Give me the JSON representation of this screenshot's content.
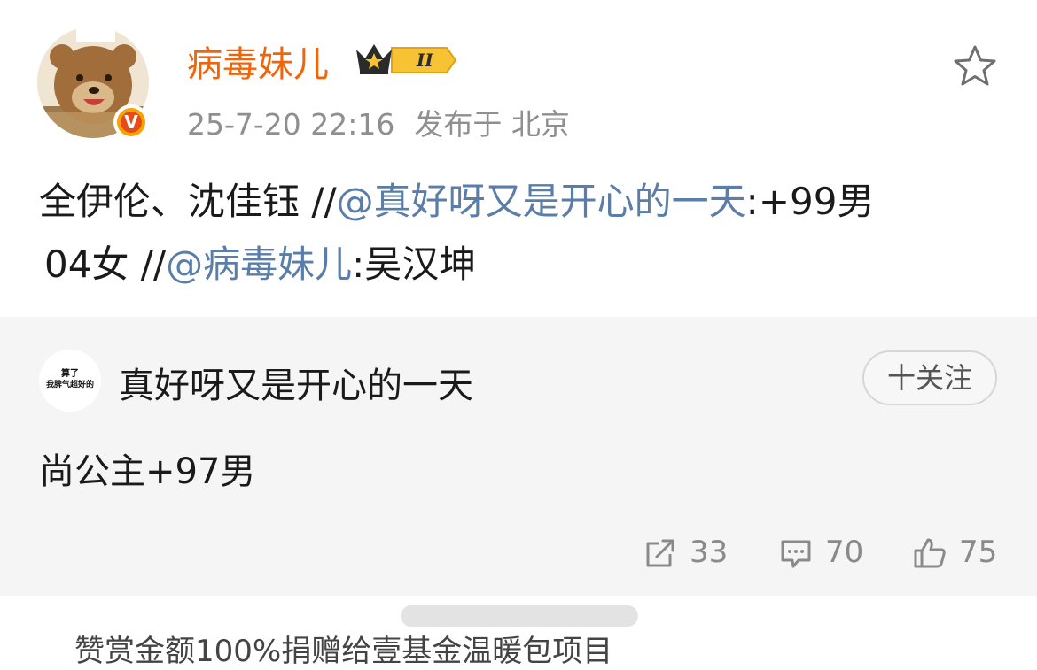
{
  "header": {
    "username": "病毒妹儿",
    "level": "II",
    "timestamp": "25-7-20 22:16",
    "location": "发布于 北京",
    "verified": "V"
  },
  "post": {
    "line1_a": "全伊伦、沈佳钰 //",
    "line1_mention": "@真好呀又是开心的一天",
    "line1_b": ":+99男",
    "line2_a": "04女 //",
    "line2_mention": "@病毒妹儿",
    "line2_b": ":吴汉坤"
  },
  "repost": {
    "avatar_line1": "算了",
    "avatar_line2": "我脾气超好的",
    "author": "真好呀又是开心的一天",
    "follow_label": "十关注",
    "text": "尚公主+97男",
    "reposts": "33",
    "comments": "70",
    "likes": "75"
  },
  "footer": {
    "partial_text": "赞赏金额100%捐赠给壹基金温暖包项目"
  },
  "colors": {
    "username": "#f2640a",
    "mention": "#5b7ea8",
    "meta": "#8f8f8f",
    "card_bg": "#f5f5f5"
  },
  "icons": [
    "star-icon",
    "crown-level-icon",
    "verified-icon",
    "repost-icon",
    "comment-icon",
    "like-icon"
  ]
}
